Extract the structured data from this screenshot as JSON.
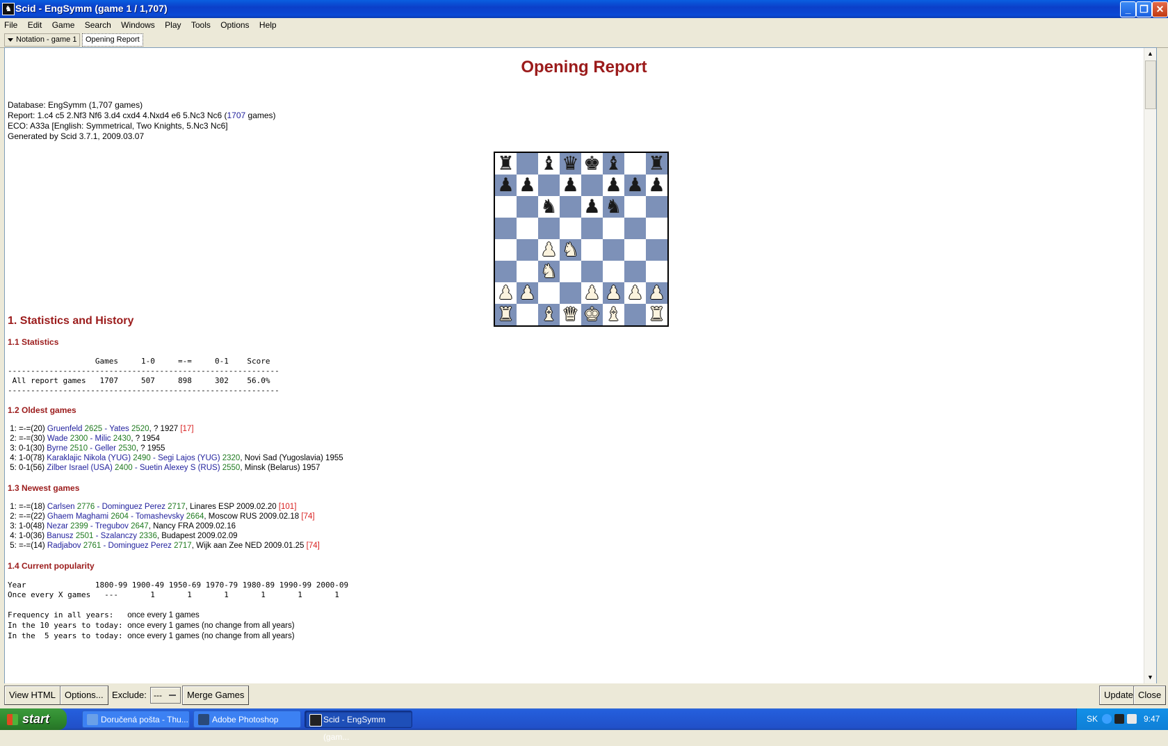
{
  "window": {
    "title": "Scid - EngSymm (game 1 / 1,707)"
  },
  "menu": [
    "File",
    "Edit",
    "Game",
    "Search",
    "Windows",
    "Play",
    "Tools",
    "Options",
    "Help"
  ],
  "tabs": {
    "notation": "Notation - game 1",
    "opening_report": "Opening Report"
  },
  "report": {
    "title": "Opening Report",
    "meta": {
      "database": "Database: EngSymm (1,707 games)",
      "report_prefix": "Report:  1.c4 c5 2.Nf3 Nf6 3.d4 cxd4 4.Nxd4 e6 5.Nc3 Nc6 (",
      "report_count": "1707",
      "report_suffix": " games)",
      "eco": "ECO: A33a [English: Symmetrical, Two Knights, 5.Nc3 Nc6]",
      "generated": "Generated by Scid 3.7.1, 2009.03.07"
    },
    "board": {
      "ranks": [
        "r.bqkb.r",
        "pp.p.ppp",
        "..n.pn..",
        "........",
        "..PN....",
        "..N.....",
        "PP..PPPP",
        "R.BQKB.R"
      ]
    },
    "section1": "1. Statistics and History",
    "stats": {
      "heading": "1.1 Statistics",
      "header_row": "                   Games     1-0     =-=     0-1    Score",
      "rule": "-----------------------------------------------------------",
      "row": " All report games   1707     507     898     302    56.0%"
    },
    "oldest": {
      "heading": "1.2 Oldest games",
      "games": [
        {
          "n": " 1:",
          "res": " =-=(20) ",
          "white": "Gruenfeld",
          "welo": " 2625",
          "sep": " - ",
          "black": "Yates",
          "belo": " 2520",
          "place": ", ? 1927 ",
          "ref": "[17]"
        },
        {
          "n": " 2:",
          "res": " =-=(30) ",
          "white": "Wade",
          "welo": " 2300",
          "sep": " - ",
          "black": "Milic",
          "belo": " 2430",
          "place": ", ? 1954",
          "ref": ""
        },
        {
          "n": " 3:",
          "res": " 0-1(30) ",
          "white": "Byrne",
          "welo": " 2510",
          "sep": " - ",
          "black": "Geller",
          "belo": " 2530",
          "place": ", ? 1955",
          "ref": ""
        },
        {
          "n": " 4:",
          "res": " 1-0(78) ",
          "white": "Karaklajic Nikola (YUG)",
          "welo": " 2490",
          "sep": " - ",
          "black": "Segi Lajos (YUG)",
          "belo": " 2320",
          "place": ", Novi Sad (Yugoslavia) 1955",
          "ref": ""
        },
        {
          "n": " 5:",
          "res": " 0-1(56) ",
          "white": "Zilber Israel (USA)",
          "welo": " 2400",
          "sep": " - ",
          "black": "Suetin Alexey S (RUS)",
          "belo": " 2550",
          "place": ", Minsk (Belarus) 1957",
          "ref": ""
        }
      ]
    },
    "newest": {
      "heading": "1.3 Newest games",
      "games": [
        {
          "n": " 1:",
          "res": " =-=(18) ",
          "white": "Carlsen",
          "welo": " 2776",
          "sep": " - ",
          "black": "Dominguez Perez",
          "belo": " 2717",
          "place": ", Linares ESP 2009.02.20 ",
          "ref": "[101]"
        },
        {
          "n": " 2:",
          "res": " =-=(22) ",
          "white": "Ghaem Maghami",
          "welo": " 2604",
          "sep": " - ",
          "black": "Tomashevsky",
          "belo": " 2664",
          "place": ", Moscow RUS 2009.02.18 ",
          "ref": "[74]"
        },
        {
          "n": " 3:",
          "res": " 1-0(48) ",
          "white": "Nezar",
          "welo": " 2399",
          "sep": " - ",
          "black": "Tregubov",
          "belo": " 2647",
          "place": ", Nancy FRA 2009.02.16",
          "ref": ""
        },
        {
          "n": " 4:",
          "res": " 1-0(36) ",
          "white": "Banusz",
          "welo": " 2501",
          "sep": " - ",
          "black": "Szalanczy",
          "belo": " 2336",
          "place": ", Budapest 2009.02.09",
          "ref": ""
        },
        {
          "n": " 5:",
          "res": " =-=(14) ",
          "white": "Radjabov",
          "welo": " 2761",
          "sep": " - ",
          "black": "Dominguez Perez",
          "belo": " 2717",
          "place": ", Wijk aan Zee NED 2009.01.25 ",
          "ref": "[74]"
        }
      ]
    },
    "popularity": {
      "heading": "1.4 Current popularity",
      "year_row": "Year               1800-99 1900-49 1950-69 1970-79 1980-89 1990-99 2000-09",
      "every_row": "Once every X games   ---       1       1       1       1       1       1",
      "freq_label_all": "Frequency in all years:   ",
      "freq_value_all": "once every 1 games",
      "freq_label_10": "In the 10 years to today: ",
      "freq_value_10": "once every 1 games (no change from all years)",
      "freq_label_5": "In the  5 years to today: ",
      "freq_value_5": "once every 1 games (no change from all years)"
    }
  },
  "bottom": {
    "view_html": "View HTML",
    "options": "Options...",
    "exclude_label": "Exclude:",
    "exclude_value": "---",
    "merge_games": "Merge Games",
    "update": "Update",
    "close": "Close"
  },
  "taskbar": {
    "start": "start",
    "items": [
      "Doručená pošta - Thu...",
      "Adobe Photoshop",
      "Scid - EngSymm (gam..."
    ],
    "lang": "SK",
    "clock": "9:47"
  }
}
